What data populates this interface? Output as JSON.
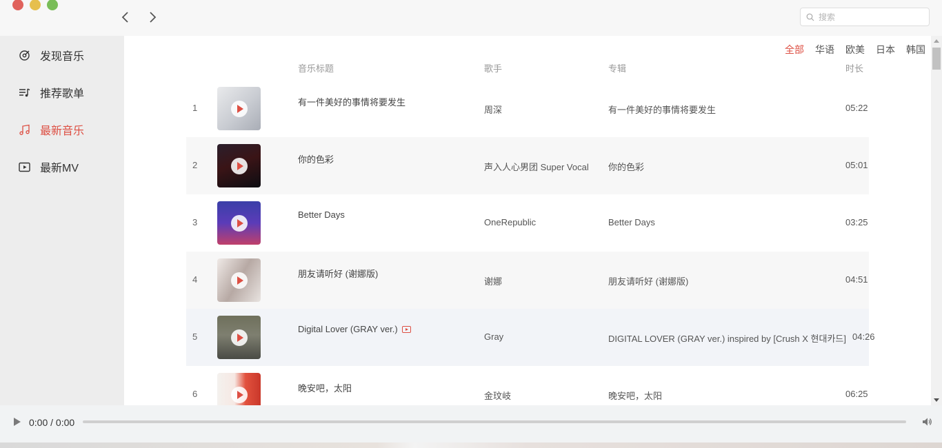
{
  "search": {
    "placeholder": "搜索"
  },
  "sidebar": {
    "items": [
      {
        "label": "发现音乐",
        "icon": "discover-icon"
      },
      {
        "label": "推荐歌单",
        "icon": "playlist-icon"
      },
      {
        "label": "最新音乐",
        "icon": "music-note-icon",
        "active": true
      },
      {
        "label": "最新MV",
        "icon": "mv-icon"
      }
    ]
  },
  "filters": [
    "全部",
    "华语",
    "欧美",
    "日本",
    "韩国"
  ],
  "active_filter": "全部",
  "table": {
    "headers": {
      "title": "音乐标题",
      "artist": "歌手",
      "album": "专辑",
      "duration": "时长"
    },
    "rows": [
      {
        "index": "1",
        "title": "有一件美好的事情将要发生",
        "artist": "周深",
        "album": "有一件美好的事情将要发生",
        "duration": "05:22",
        "has_mv": false
      },
      {
        "index": "2",
        "title": "你的色彩",
        "artist": "声入人心男团 Super Vocal",
        "album": "你的色彩",
        "duration": "05:01",
        "has_mv": false
      },
      {
        "index": "3",
        "title": "Better Days",
        "artist": "OneRepublic",
        "album": "Better Days",
        "duration": "03:25",
        "has_mv": false
      },
      {
        "index": "4",
        "title": "朋友请听好 (谢娜版)",
        "artist": "谢娜",
        "album": "朋友请听好 (谢娜版)",
        "duration": "04:51",
        "has_mv": false
      },
      {
        "index": "5",
        "title": "Digital Lover (GRAY ver.)",
        "artist": "Gray",
        "album": "DIGITAL LOVER (GRAY ver.) inspired by [Crush X 현대카드]",
        "duration": "04:26",
        "has_mv": true
      },
      {
        "index": "6",
        "title": "晚安吧，太阳",
        "artist": "金玟岐",
        "album": "晚安吧，太阳",
        "duration": "06:25",
        "has_mv": false
      }
    ]
  },
  "player": {
    "time": "0:00 / 0:00",
    "progress": 0
  },
  "colors": {
    "accent": "#dd4f43",
    "sidebar_bg": "#ededed",
    "row_alt": "#f7f7f7"
  }
}
